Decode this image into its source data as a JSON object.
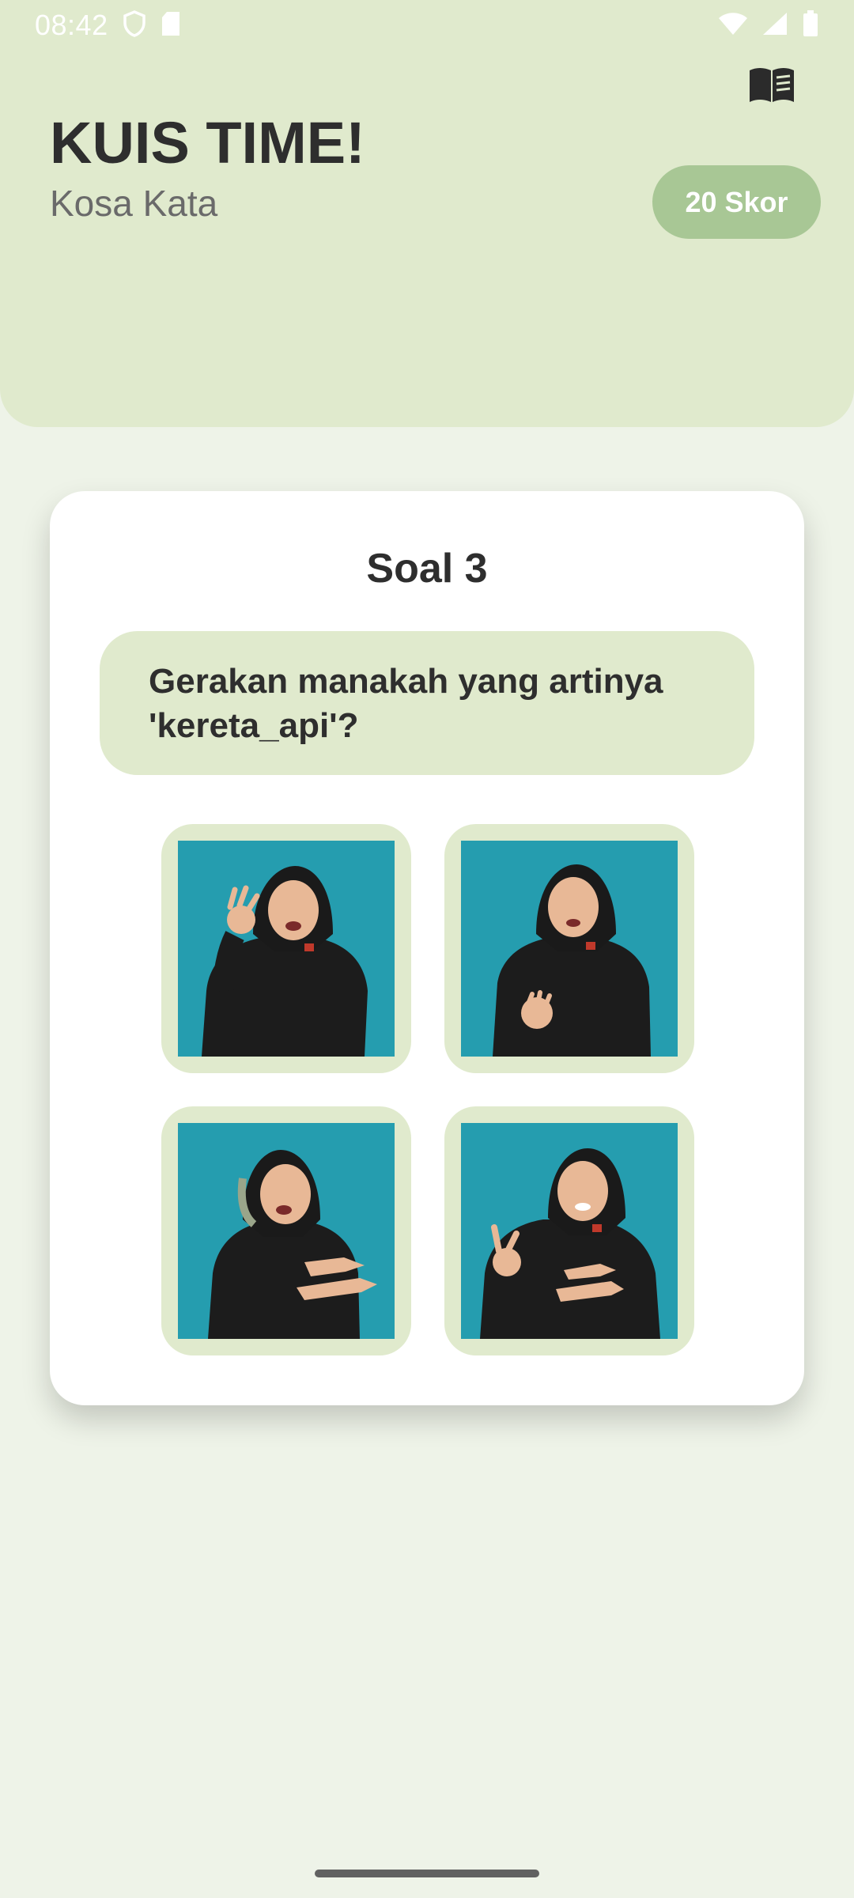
{
  "status_bar": {
    "time": "08:42",
    "icons_left": [
      "shield-icon",
      "sd-card-icon"
    ],
    "icons_right": [
      "wifi-icon",
      "signal-icon",
      "battery-icon"
    ]
  },
  "header": {
    "title": "KUIS TIME!",
    "subtitle": "Kosa Kata",
    "score_label": "20 Skor",
    "book_icon": "book-icon"
  },
  "quiz": {
    "question_number_label": "Soal 3",
    "question_text": "Gerakan manakah yang artinya 'kereta_api'?",
    "options": [
      {
        "id": 1,
        "image": "sign-image-1"
      },
      {
        "id": 2,
        "image": "sign-image-2"
      },
      {
        "id": 3,
        "image": "sign-image-3"
      },
      {
        "id": 4,
        "image": "sign-image-4"
      }
    ]
  },
  "colors": {
    "header_bg": "#e0eacd",
    "page_bg": "#eef3e8",
    "score_badge": "#a8c795",
    "image_bg": "#259daf"
  }
}
